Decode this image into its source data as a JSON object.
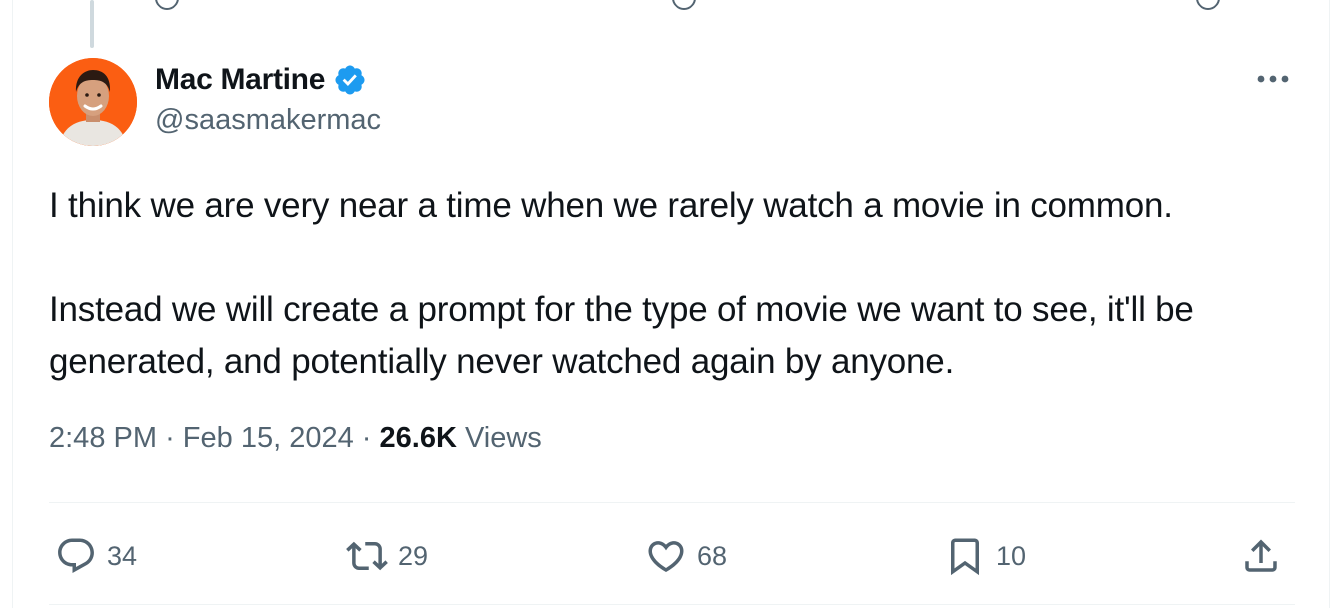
{
  "author": {
    "name": "Mac Martine",
    "handle": "@saasmakermac",
    "verified": true,
    "avatar_bg": "#fb5e12",
    "verified_color": "#1d9bf0"
  },
  "tweet": {
    "paragraphs": [
      "I think we are very near a time when we rarely watch a movie in common.",
      "Instead we will create a prompt for the type of movie we want to see, it'll be generated, and potentially never watched again by anyone."
    ]
  },
  "meta": {
    "time": "2:48 PM",
    "separator": "·",
    "date": "Feb 15, 2024",
    "views_count": "26.6K",
    "views_label": "Views"
  },
  "actions": {
    "replies": "34",
    "retweets": "29",
    "likes": "68",
    "bookmarks": "10"
  },
  "icons": {
    "more": "more-horizontal-icon",
    "reply": "reply-icon",
    "retweet": "retweet-icon",
    "like": "heart-icon",
    "bookmark": "bookmark-icon",
    "share": "share-icon"
  }
}
